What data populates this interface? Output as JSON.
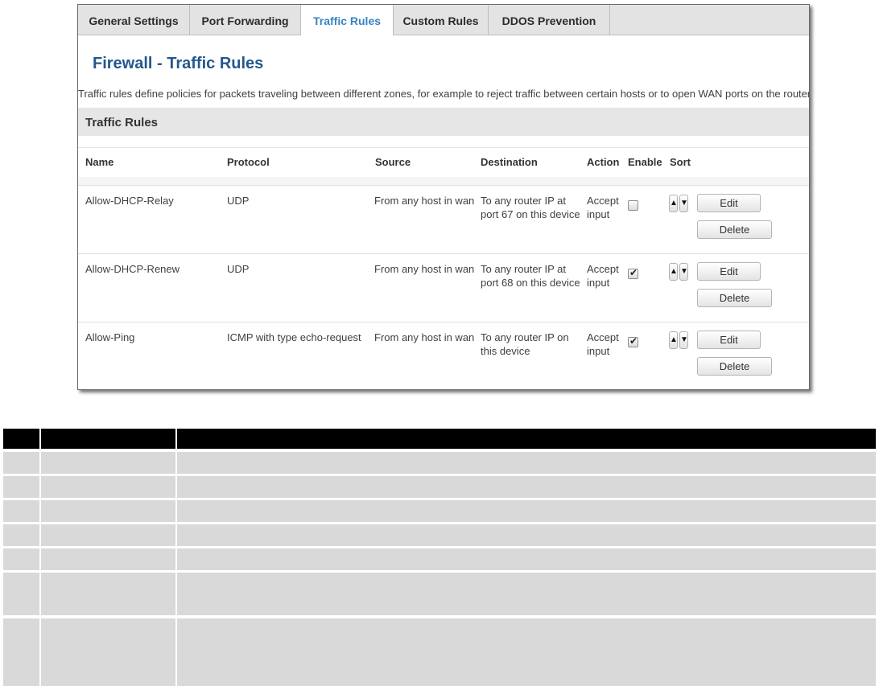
{
  "tabs": [
    {
      "label": "General Settings",
      "active": false
    },
    {
      "label": "Port Forwarding",
      "active": false
    },
    {
      "label": "Traffic Rules",
      "active": true
    },
    {
      "label": "Custom Rules",
      "active": false
    },
    {
      "label": "DDOS Prevention",
      "active": false
    }
  ],
  "page_title": "Firewall - Traffic Rules",
  "description": "Traffic rules define policies for packets traveling between different zones, for example to reject traffic between certain hosts or to open WAN ports on the router.",
  "section_title": "Traffic Rules",
  "columns": {
    "name": "Name",
    "protocol": "Protocol",
    "source": "Source",
    "destination": "Destination",
    "action": "Action",
    "enable": "Enable",
    "sort": "Sort"
  },
  "rules": [
    {
      "name": "Allow-DHCP-Relay",
      "protocol": "UDP",
      "source": "From any host in wan",
      "destination_line1": "To any router IP at",
      "destination_line2": "port 67 on this device",
      "action_line1": "Accept",
      "action_line2": "input",
      "enabled": false,
      "edit_label": "Edit",
      "delete_label": "Delete"
    },
    {
      "name": "Allow-DHCP-Renew",
      "protocol": "UDP",
      "source": "From any host in wan",
      "destination_line1": "To any router IP at",
      "destination_line2": "port 68 on this device",
      "action_line1": "Accept",
      "action_line2": "input",
      "enabled": true,
      "edit_label": "Edit",
      "delete_label": "Delete"
    },
    {
      "name": "Allow-Ping",
      "protocol": "ICMP with type echo-request",
      "source": "From any host in wan",
      "destination_line1": "To any router IP on",
      "destination_line2": "this device",
      "action_line1": "Accept",
      "action_line2": "input",
      "enabled": true,
      "edit_label": "Edit",
      "delete_label": "Delete"
    }
  ],
  "icons": {
    "sort_up": "arrow-up-icon",
    "sort_down": "arrow-down-icon",
    "checkmark": "checkmark-icon"
  },
  "colors": {
    "title_blue": "#24588f",
    "active_tab": "#3a82c4",
    "tab_bar": "#e3e3e3",
    "section_header": "#e6e6e6",
    "bottom_header": "#000000",
    "bottom_row": "#d9d9d9"
  },
  "bottom_table": {
    "header": [
      "",
      "",
      ""
    ],
    "rows": [
      [
        "",
        "",
        ""
      ],
      [
        "",
        "",
        ""
      ],
      [
        "",
        "",
        ""
      ],
      [
        "",
        "",
        ""
      ],
      [
        "",
        "",
        ""
      ],
      [
        "",
        "",
        ""
      ],
      [
        "",
        "",
        ""
      ]
    ]
  }
}
